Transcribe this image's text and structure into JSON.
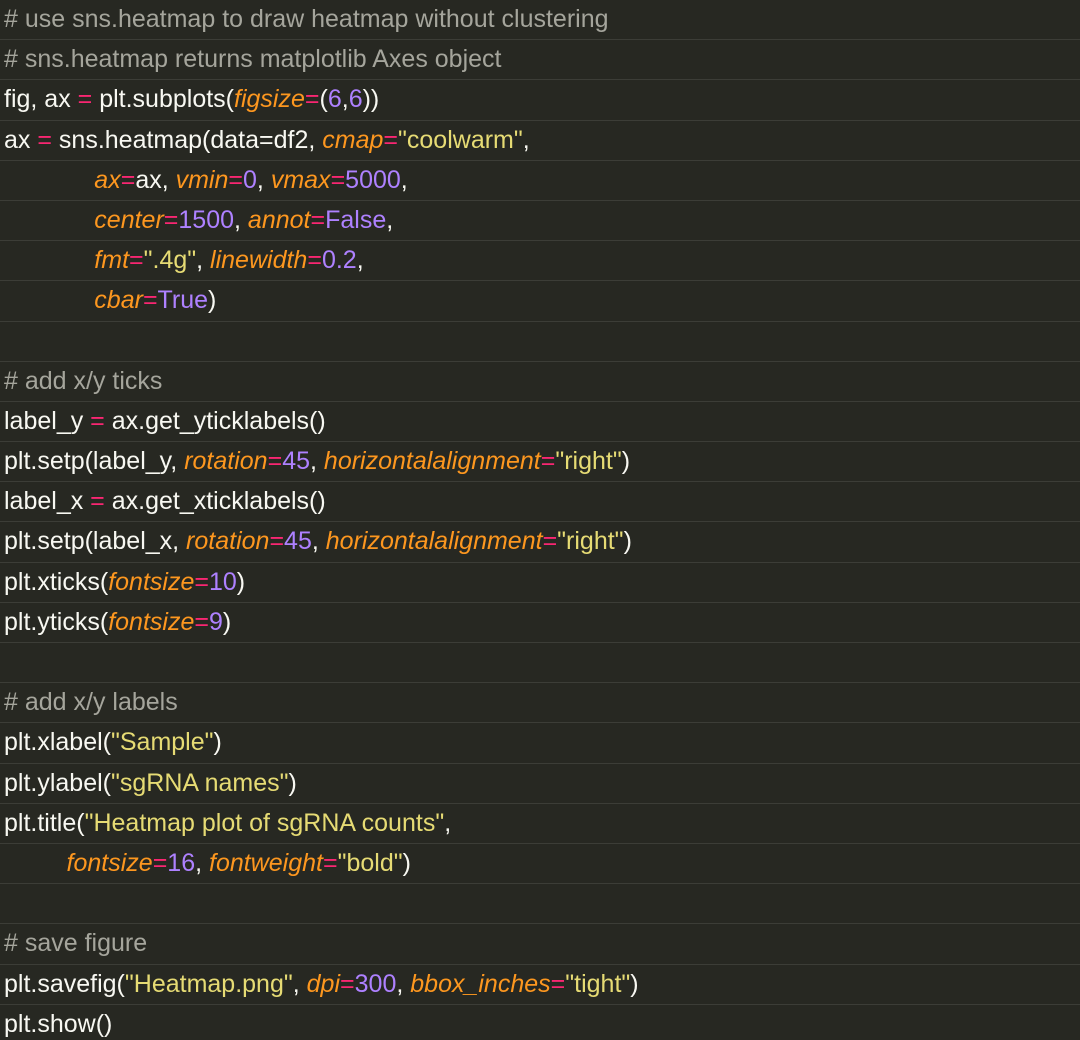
{
  "editor": {
    "language": "python",
    "colors": {
      "background": "#272822",
      "comment": "#a5a59c",
      "operator": "#f92672",
      "parameter": "#fd971f",
      "number": "#ae81ff",
      "string": "#e6db74",
      "plain": "#f8f8f2"
    },
    "lines": [
      [
        {
          "t": "comment",
          "v": "# use sns.heatmap to draw heatmap without clustering"
        }
      ],
      [
        {
          "t": "comment",
          "v": "# sns.heatmap returns matplotlib Axes object"
        }
      ],
      [
        {
          "t": "plain",
          "v": "fig, ax "
        },
        {
          "t": "op",
          "v": "="
        },
        {
          "t": "plain",
          "v": " plt.subplots("
        },
        {
          "t": "param",
          "v": "figsize"
        },
        {
          "t": "op",
          "v": "="
        },
        {
          "t": "plain",
          "v": "("
        },
        {
          "t": "num",
          "v": "6"
        },
        {
          "t": "plain",
          "v": ","
        },
        {
          "t": "num",
          "v": "6"
        },
        {
          "t": "plain",
          "v": "))"
        }
      ],
      [
        {
          "t": "plain",
          "v": "ax "
        },
        {
          "t": "op",
          "v": "="
        },
        {
          "t": "plain",
          "v": " sns.heatmap(data=df2, "
        },
        {
          "t": "param",
          "v": "cmap"
        },
        {
          "t": "op",
          "v": "="
        },
        {
          "t": "str",
          "v": "\"coolwarm\""
        },
        {
          "t": "plain",
          "v": ","
        }
      ],
      [
        {
          "t": "plain",
          "v": "             "
        },
        {
          "t": "param",
          "v": "ax"
        },
        {
          "t": "op",
          "v": "="
        },
        {
          "t": "plain",
          "v": "ax, "
        },
        {
          "t": "param",
          "v": "vmin"
        },
        {
          "t": "op",
          "v": "="
        },
        {
          "t": "num",
          "v": "0"
        },
        {
          "t": "plain",
          "v": ", "
        },
        {
          "t": "param",
          "v": "vmax"
        },
        {
          "t": "op",
          "v": "="
        },
        {
          "t": "num",
          "v": "5000"
        },
        {
          "t": "plain",
          "v": ","
        }
      ],
      [
        {
          "t": "plain",
          "v": "             "
        },
        {
          "t": "param",
          "v": "center"
        },
        {
          "t": "op",
          "v": "="
        },
        {
          "t": "num",
          "v": "1500"
        },
        {
          "t": "plain",
          "v": ", "
        },
        {
          "t": "param",
          "v": "annot"
        },
        {
          "t": "op",
          "v": "="
        },
        {
          "t": "const",
          "v": "False"
        },
        {
          "t": "plain",
          "v": ","
        }
      ],
      [
        {
          "t": "plain",
          "v": "             "
        },
        {
          "t": "param",
          "v": "fmt"
        },
        {
          "t": "op",
          "v": "="
        },
        {
          "t": "str",
          "v": "\".4g\""
        },
        {
          "t": "plain",
          "v": ", "
        },
        {
          "t": "param",
          "v": "linewidth"
        },
        {
          "t": "op",
          "v": "="
        },
        {
          "t": "num",
          "v": "0.2"
        },
        {
          "t": "plain",
          "v": ","
        }
      ],
      [
        {
          "t": "plain",
          "v": "             "
        },
        {
          "t": "param",
          "v": "cbar"
        },
        {
          "t": "op",
          "v": "="
        },
        {
          "t": "const",
          "v": "True"
        },
        {
          "t": "plain",
          "v": ")"
        }
      ],
      [],
      [
        {
          "t": "comment",
          "v": "# add x/y ticks"
        }
      ],
      [
        {
          "t": "plain",
          "v": "label_y "
        },
        {
          "t": "op",
          "v": "="
        },
        {
          "t": "plain",
          "v": " ax.get_yticklabels()"
        }
      ],
      [
        {
          "t": "plain",
          "v": "plt.setp(label_y, "
        },
        {
          "t": "param",
          "v": "rotation"
        },
        {
          "t": "op",
          "v": "="
        },
        {
          "t": "num",
          "v": "45"
        },
        {
          "t": "plain",
          "v": ", "
        },
        {
          "t": "param",
          "v": "horizontalalignment"
        },
        {
          "t": "op",
          "v": "="
        },
        {
          "t": "str",
          "v": "\"right\""
        },
        {
          "t": "plain",
          "v": ")"
        }
      ],
      [
        {
          "t": "plain",
          "v": "label_x "
        },
        {
          "t": "op",
          "v": "="
        },
        {
          "t": "plain",
          "v": " ax.get_xticklabels()"
        }
      ],
      [
        {
          "t": "plain",
          "v": "plt.setp(label_x, "
        },
        {
          "t": "param",
          "v": "rotation"
        },
        {
          "t": "op",
          "v": "="
        },
        {
          "t": "num",
          "v": "45"
        },
        {
          "t": "plain",
          "v": ", "
        },
        {
          "t": "param",
          "v": "horizontalalignment"
        },
        {
          "t": "op",
          "v": "="
        },
        {
          "t": "str",
          "v": "\"right\""
        },
        {
          "t": "plain",
          "v": ")"
        }
      ],
      [
        {
          "t": "plain",
          "v": "plt.xticks("
        },
        {
          "t": "param",
          "v": "fontsize"
        },
        {
          "t": "op",
          "v": "="
        },
        {
          "t": "num",
          "v": "10"
        },
        {
          "t": "plain",
          "v": ")"
        }
      ],
      [
        {
          "t": "plain",
          "v": "plt.yticks("
        },
        {
          "t": "param",
          "v": "fontsize"
        },
        {
          "t": "op",
          "v": "="
        },
        {
          "t": "num",
          "v": "9"
        },
        {
          "t": "plain",
          "v": ")"
        }
      ],
      [],
      [
        {
          "t": "comment",
          "v": "# add x/y labels"
        }
      ],
      [
        {
          "t": "plain",
          "v": "plt.xlabel("
        },
        {
          "t": "str",
          "v": "\"Sample\""
        },
        {
          "t": "plain",
          "v": ")"
        }
      ],
      [
        {
          "t": "plain",
          "v": "plt.ylabel("
        },
        {
          "t": "str",
          "v": "\"sgRNA names\""
        },
        {
          "t": "plain",
          "v": ")"
        }
      ],
      [
        {
          "t": "plain",
          "v": "plt.title("
        },
        {
          "t": "str",
          "v": "\"Heatmap plot of sgRNA counts\""
        },
        {
          "t": "plain",
          "v": ","
        }
      ],
      [
        {
          "t": "plain",
          "v": "         "
        },
        {
          "t": "param",
          "v": "fontsize"
        },
        {
          "t": "op",
          "v": "="
        },
        {
          "t": "num",
          "v": "16"
        },
        {
          "t": "plain",
          "v": ", "
        },
        {
          "t": "param",
          "v": "fontweight"
        },
        {
          "t": "op",
          "v": "="
        },
        {
          "t": "str",
          "v": "\"bold\""
        },
        {
          "t": "plain",
          "v": ")"
        }
      ],
      [],
      [
        {
          "t": "comment",
          "v": "# save figure"
        }
      ],
      [
        {
          "t": "plain",
          "v": "plt.savefig("
        },
        {
          "t": "str",
          "v": "\"Heatmap.png\""
        },
        {
          "t": "plain",
          "v": ", "
        },
        {
          "t": "param",
          "v": "dpi"
        },
        {
          "t": "op",
          "v": "="
        },
        {
          "t": "num",
          "v": "300"
        },
        {
          "t": "plain",
          "v": ", "
        },
        {
          "t": "param",
          "v": "bbox_inches"
        },
        {
          "t": "op",
          "v": "="
        },
        {
          "t": "str",
          "v": "\"tight\""
        },
        {
          "t": "plain",
          "v": ")"
        }
      ],
      [
        {
          "t": "plain",
          "v": "plt.show()"
        }
      ]
    ]
  }
}
